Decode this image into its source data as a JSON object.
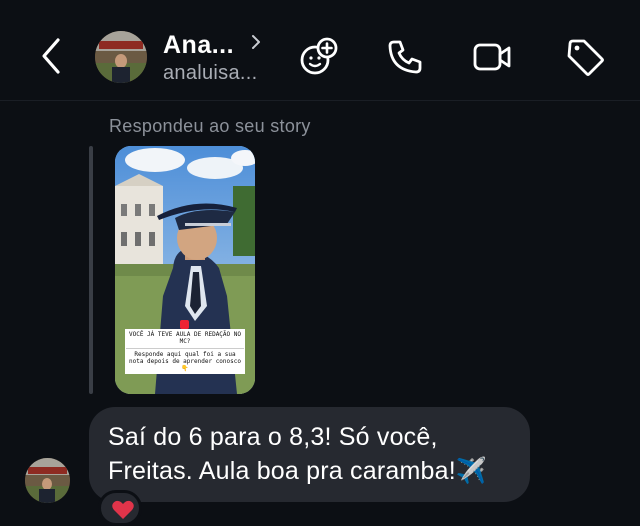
{
  "header": {
    "name": "Ana...",
    "handle": "analuisa...",
    "icons": [
      "back-chevron-icon",
      "chevron-right-icon",
      "sticker-plus-icon",
      "phone-icon",
      "video-camera-icon",
      "tag-icon"
    ]
  },
  "thread": {
    "reply_label": "Respondeu ao seu story",
    "story": {
      "question": "VOCÊ JÁ TEVE AULA DE REDAÇÃO NO MC?",
      "subtitle": "Responde aqui qual foi a sua nota depois de aprender conosco👇"
    },
    "message": {
      "line1": "Saí do 6 para o 8,3! Só você,",
      "line2": "Freitas. Aula boa pra caramba!✈️",
      "reaction": "❤️"
    }
  },
  "colors": {
    "background": "#0c0f14",
    "bubble": "#262930",
    "muted_text": "#8c919a",
    "reaction_red": "#e0344a"
  }
}
